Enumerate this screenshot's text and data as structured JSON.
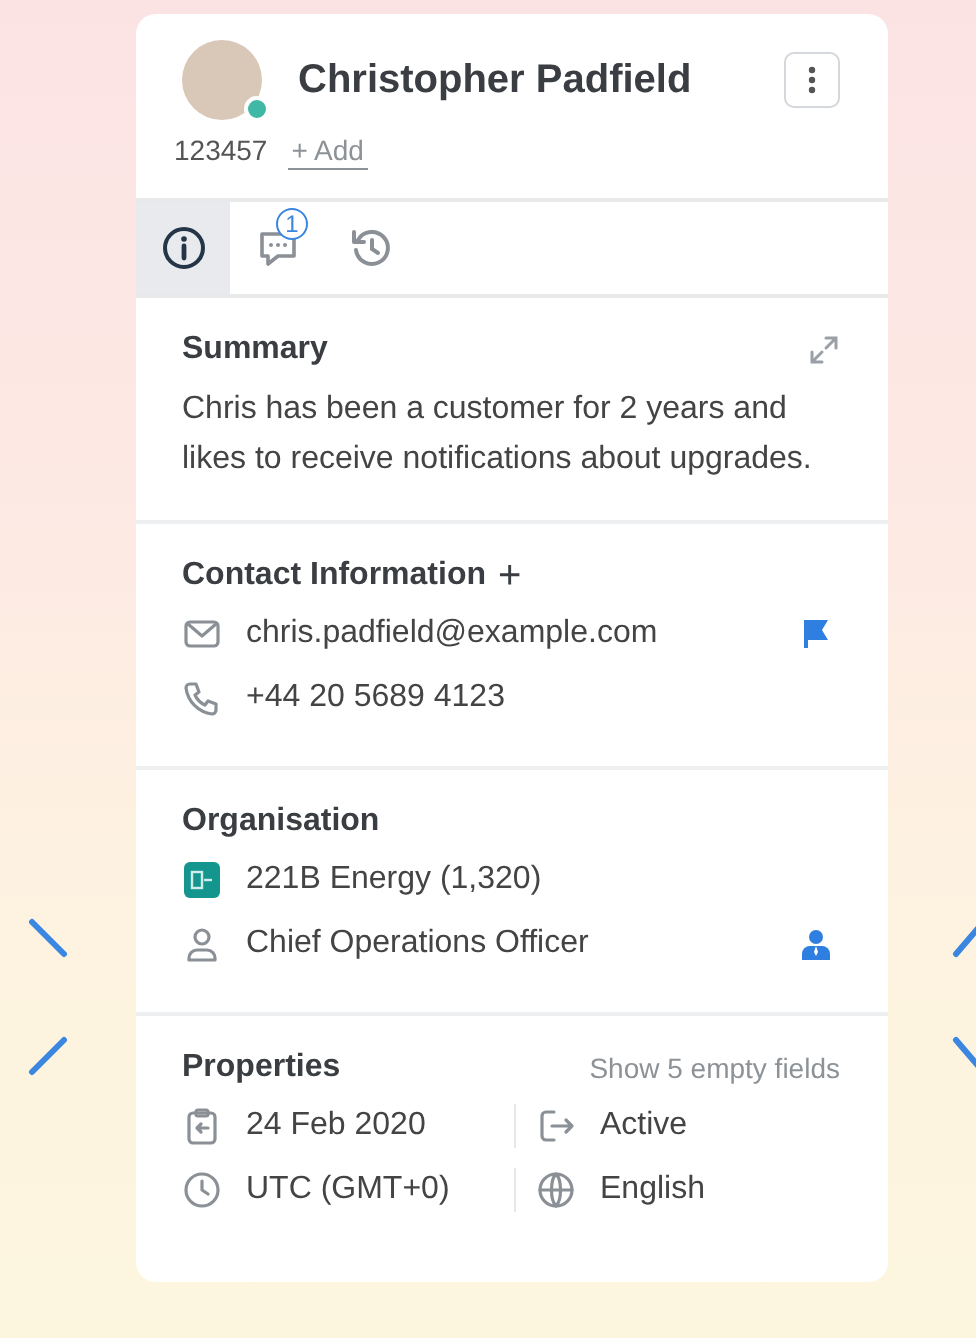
{
  "contact": {
    "name": "Christopher Padfield",
    "id": "123457",
    "add_label": "+ Add",
    "online": true
  },
  "tabs": [
    {
      "kind": "info",
      "selected": true
    },
    {
      "kind": "chat",
      "selected": false,
      "badge": "1"
    },
    {
      "kind": "history",
      "selected": false
    }
  ],
  "summary": {
    "title": "Summary",
    "text": "Chris has been a customer for 2 years and likes to receive notifications about upgrades."
  },
  "contact_information": {
    "title": "Contact Information",
    "add": "+",
    "items": [
      {
        "kind": "email",
        "value": "chris.padfield@example.com",
        "flagged": true
      },
      {
        "kind": "phone",
        "value": "+44 20 5689 4123",
        "flagged": false
      }
    ]
  },
  "organisation": {
    "title": "Organisation",
    "items": [
      {
        "kind": "company",
        "value": "221B Energy (1,320)",
        "marked": false
      },
      {
        "kind": "role",
        "value": "Chief Operations Officer",
        "marked": true
      }
    ]
  },
  "properties": {
    "title": "Properties",
    "link": "Show 5 empty fields",
    "items": [
      {
        "kind": "date",
        "value": "24 Feb 2020"
      },
      {
        "kind": "status",
        "value": "Active"
      },
      {
        "kind": "timezone",
        "value": "UTC (GMT+0)"
      },
      {
        "kind": "language",
        "value": "English"
      }
    ]
  }
}
